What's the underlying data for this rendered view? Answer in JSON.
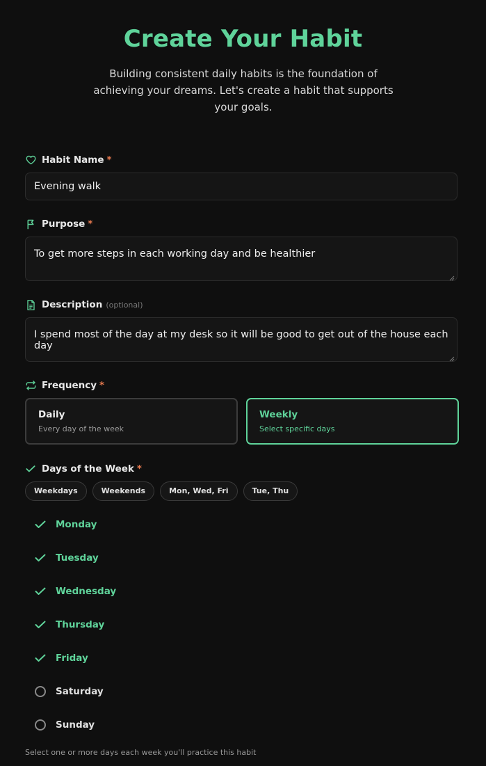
{
  "header": {
    "title": "Create Your Habit",
    "subtitle": "Building consistent daily habits is the foundation of achieving your dreams. Let's create a habit that supports your goals."
  },
  "form": {
    "habit_name": {
      "label": "Habit Name",
      "required_mark": "*",
      "icon": "heart-icon",
      "value": "Evening walk"
    },
    "purpose": {
      "label": "Purpose",
      "required_mark": "*",
      "icon": "flag-icon",
      "value": "To get more steps in each working day and be healthier"
    },
    "description": {
      "label": "Description",
      "optional_note": "(optional)",
      "icon": "document-icon",
      "value": "I spend most of the day at my desk so it will be good to get out of the house each day"
    },
    "frequency": {
      "label": "Frequency",
      "required_mark": "*",
      "icon": "repeat-icon",
      "selected": "Weekly",
      "options": [
        {
          "title": "Daily",
          "subtitle": "Every day of the week"
        },
        {
          "title": "Weekly",
          "subtitle": "Select specific days"
        }
      ]
    },
    "days": {
      "label": "Days of the Week",
      "required_mark": "*",
      "icon": "check-icon",
      "presets": [
        "Weekdays",
        "Weekends",
        "Mon, Wed, Fri",
        "Tue, Thu"
      ],
      "items": [
        {
          "label": "Monday",
          "checked": true
        },
        {
          "label": "Tuesday",
          "checked": true
        },
        {
          "label": "Wednesday",
          "checked": true
        },
        {
          "label": "Thursday",
          "checked": true
        },
        {
          "label": "Friday",
          "checked": true
        },
        {
          "label": "Saturday",
          "checked": false
        },
        {
          "label": "Sunday",
          "checked": false
        }
      ],
      "helper": "Select one or more days each week you'll practice this habit"
    }
  },
  "colors": {
    "accent": "#5fd39a",
    "required": "#e87a4f",
    "background": "#0f0f0f",
    "field_bg": "#151515"
  }
}
